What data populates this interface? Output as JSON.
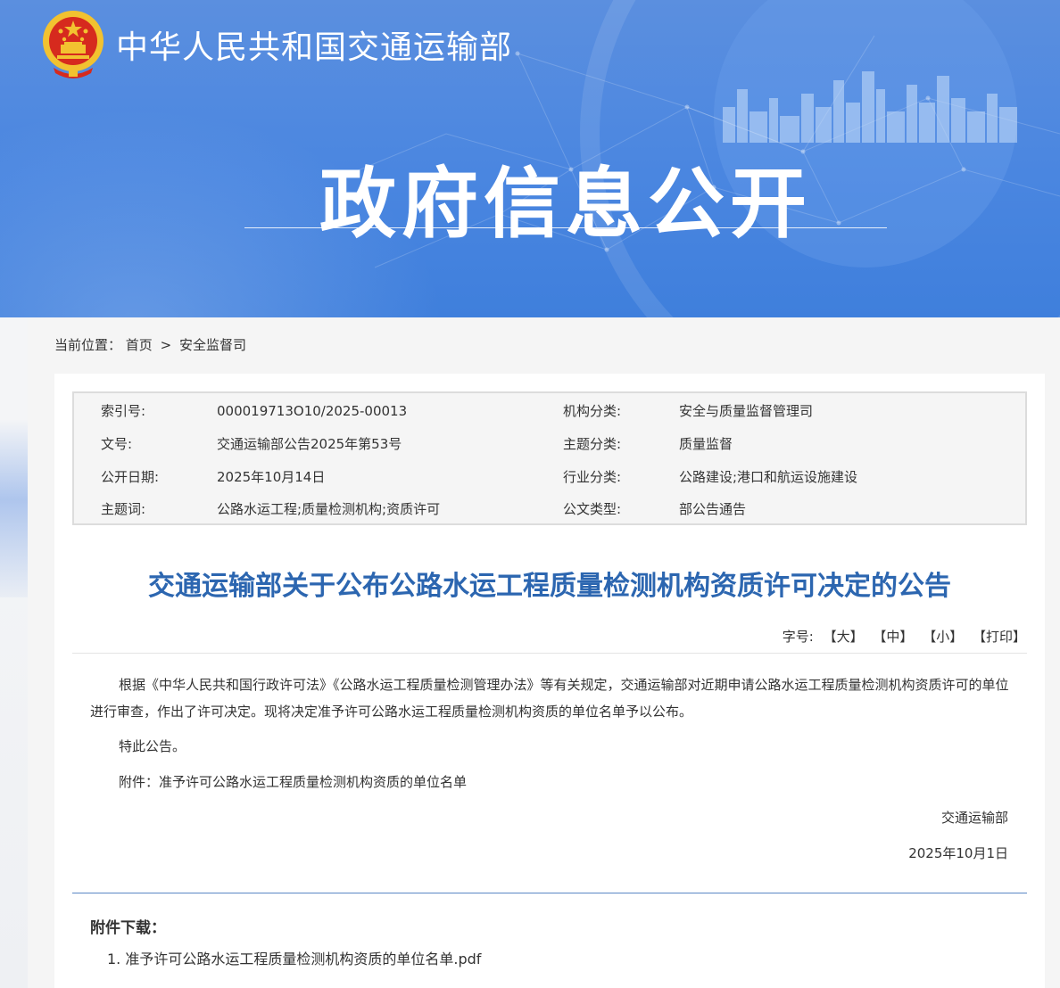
{
  "header": {
    "site_title": "中华人民共和国交通运输部",
    "hero_title": "政府信息公开"
  },
  "breadcrumb": {
    "label": "当前位置：",
    "home": "首页",
    "separator": ">",
    "current": "安全监督司"
  },
  "meta": {
    "rows": [
      {
        "k1": "索引号:",
        "v1": "000019713O10/2025-00013",
        "k2": "机构分类:",
        "v2": "安全与质量监督管理司"
      },
      {
        "k1": "文号:",
        "v1": "交通运输部公告2025年第53号",
        "k2": "主题分类:",
        "v2": "质量监督"
      },
      {
        "k1": "公开日期:",
        "v1": "2025年10月14日",
        "k2": "行业分类:",
        "v2": "公路建设;港口和航运设施建设"
      },
      {
        "k1": "主题词:",
        "v1": "公路水运工程;质量检测机构;资质许可",
        "k2": "公文类型:",
        "v2": "部公告通告"
      }
    ]
  },
  "article": {
    "title": "交通运输部关于公布公路水运工程质量检测机构资质许可决定的公告",
    "font_label": "字号:",
    "font_large": "【大】",
    "font_medium": "【中】",
    "font_small": "【小】",
    "print": "【打印】",
    "paragraph1": "根据《中华人民共和国行政许可法》《公路水运工程质量检测管理办法》等有关规定，交通运输部对近期申请公路水运工程质量检测机构资质许可的单位进行审查，作出了许可决定。现将决定准予许可公路水运工程质量检测机构资质的单位名单予以公布。",
    "paragraph2": "特此公告。",
    "paragraph3": "附件：准予许可公路水运工程质量检测机构资质的单位名单",
    "signature": "交通运输部",
    "date": "2025年10月1日"
  },
  "downloads": {
    "title": "附件下载：",
    "items": [
      {
        "index": "1.",
        "name": "准予许可公路水运工程质量检测机构资质的单位名单.pdf"
      }
    ]
  },
  "colors": {
    "banner_blue": "#4a86e0",
    "title_blue": "#2c66b0",
    "emblem_red": "#d62a1e",
    "emblem_gold": "#f2c230"
  },
  "icons": {
    "emblem": "national-emblem-icon"
  }
}
